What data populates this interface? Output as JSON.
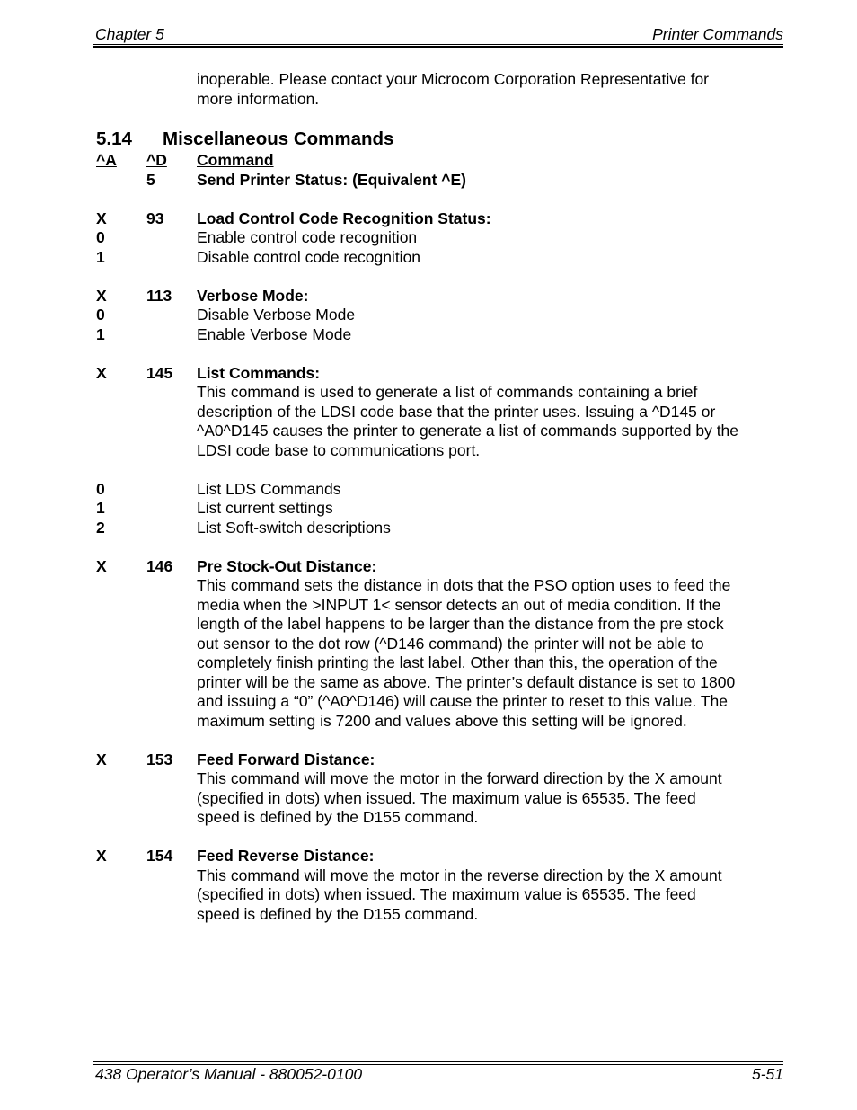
{
  "header": {
    "chapter": "Chapter 5",
    "section": "Printer Commands"
  },
  "footer": {
    "manual": "438 Operator’s Manual - 880052-0100",
    "page": "5-51"
  },
  "intro": {
    "lines": [
      "inoperable.  Please contact your Microcom Corporation Representative for",
      "more information."
    ]
  },
  "section": {
    "number": "5.14",
    "title": "Miscellaneous Commands"
  },
  "table_header": {
    "col_a": "^A",
    "col_d": "^D",
    "col_command": "Command"
  },
  "commands": [
    {
      "a": "",
      "d": "5",
      "name": "Send Printer Status:  (Equivalent ^E)",
      "description": [],
      "options": []
    },
    {
      "a": "X",
      "d": "93",
      "name": "Load Control Code Recognition Status:",
      "description": [],
      "options": [
        {
          "value": "0",
          "label": "Enable control code recognition"
        },
        {
          "value": "1",
          "label": "Disable control code recognition"
        }
      ]
    },
    {
      "a": "X",
      "d": "113",
      "name": "Verbose Mode:",
      "description": [],
      "options": [
        {
          "value": "0",
          "label": "Disable Verbose Mode"
        },
        {
          "value": "1",
          "label": "Enable Verbose Mode"
        }
      ]
    },
    {
      "a": "X",
      "d": "145",
      "name": "List Commands:",
      "description": [
        "This command is used to generate a list of commands containing a brief",
        "description of the LDSI code base that the printer uses.  Issuing a ^D145 or",
        "^A0^D145 causes the printer to generate a list of commands supported by the",
        "LDSI code base to communications port."
      ],
      "options": [
        {
          "value": "0",
          "label": "List LDS Commands"
        },
        {
          "value": "1",
          "label": "List current settings"
        },
        {
          "value": "2",
          "label": "List Soft-switch descriptions"
        }
      ]
    },
    {
      "a": "X",
      "d": "146",
      "name": "Pre Stock-Out Distance:",
      "description": [
        "This command sets the distance in dots that the PSO option uses to feed the",
        "media when the >INPUT 1< sensor detects an out of media condition.  If the",
        "length of the label happens to be larger than the distance from the pre stock",
        "out sensor to the dot row (^D146 command) the printer will not be able to",
        "completely finish printing the last label. Other than this, the operation of the",
        "printer will be the same as above.  The printer’s default distance is set to 1800",
        "and issuing a “0” (^A0^D146) will cause the printer to reset to this value.  The",
        "maximum setting is 7200 and values above this setting will be ignored."
      ],
      "options": []
    },
    {
      "a": "X",
      "d": "153",
      "name": "Feed Forward Distance:",
      "description": [
        "This command will move the motor in the forward direction by the X amount",
        "(specified in dots) when issued.  The maximum value is 65535.  The feed",
        "speed is defined by the D155 command."
      ],
      "options": []
    },
    {
      "a": "X",
      "d": "154",
      "name": "Feed Reverse Distance:",
      "description": [
        "This command will move the motor in the reverse direction by the X amount",
        "(specified in dots) when issued.  The maximum value is 65535.  The feed",
        "speed is defined by the D155 command."
      ],
      "options": []
    }
  ]
}
